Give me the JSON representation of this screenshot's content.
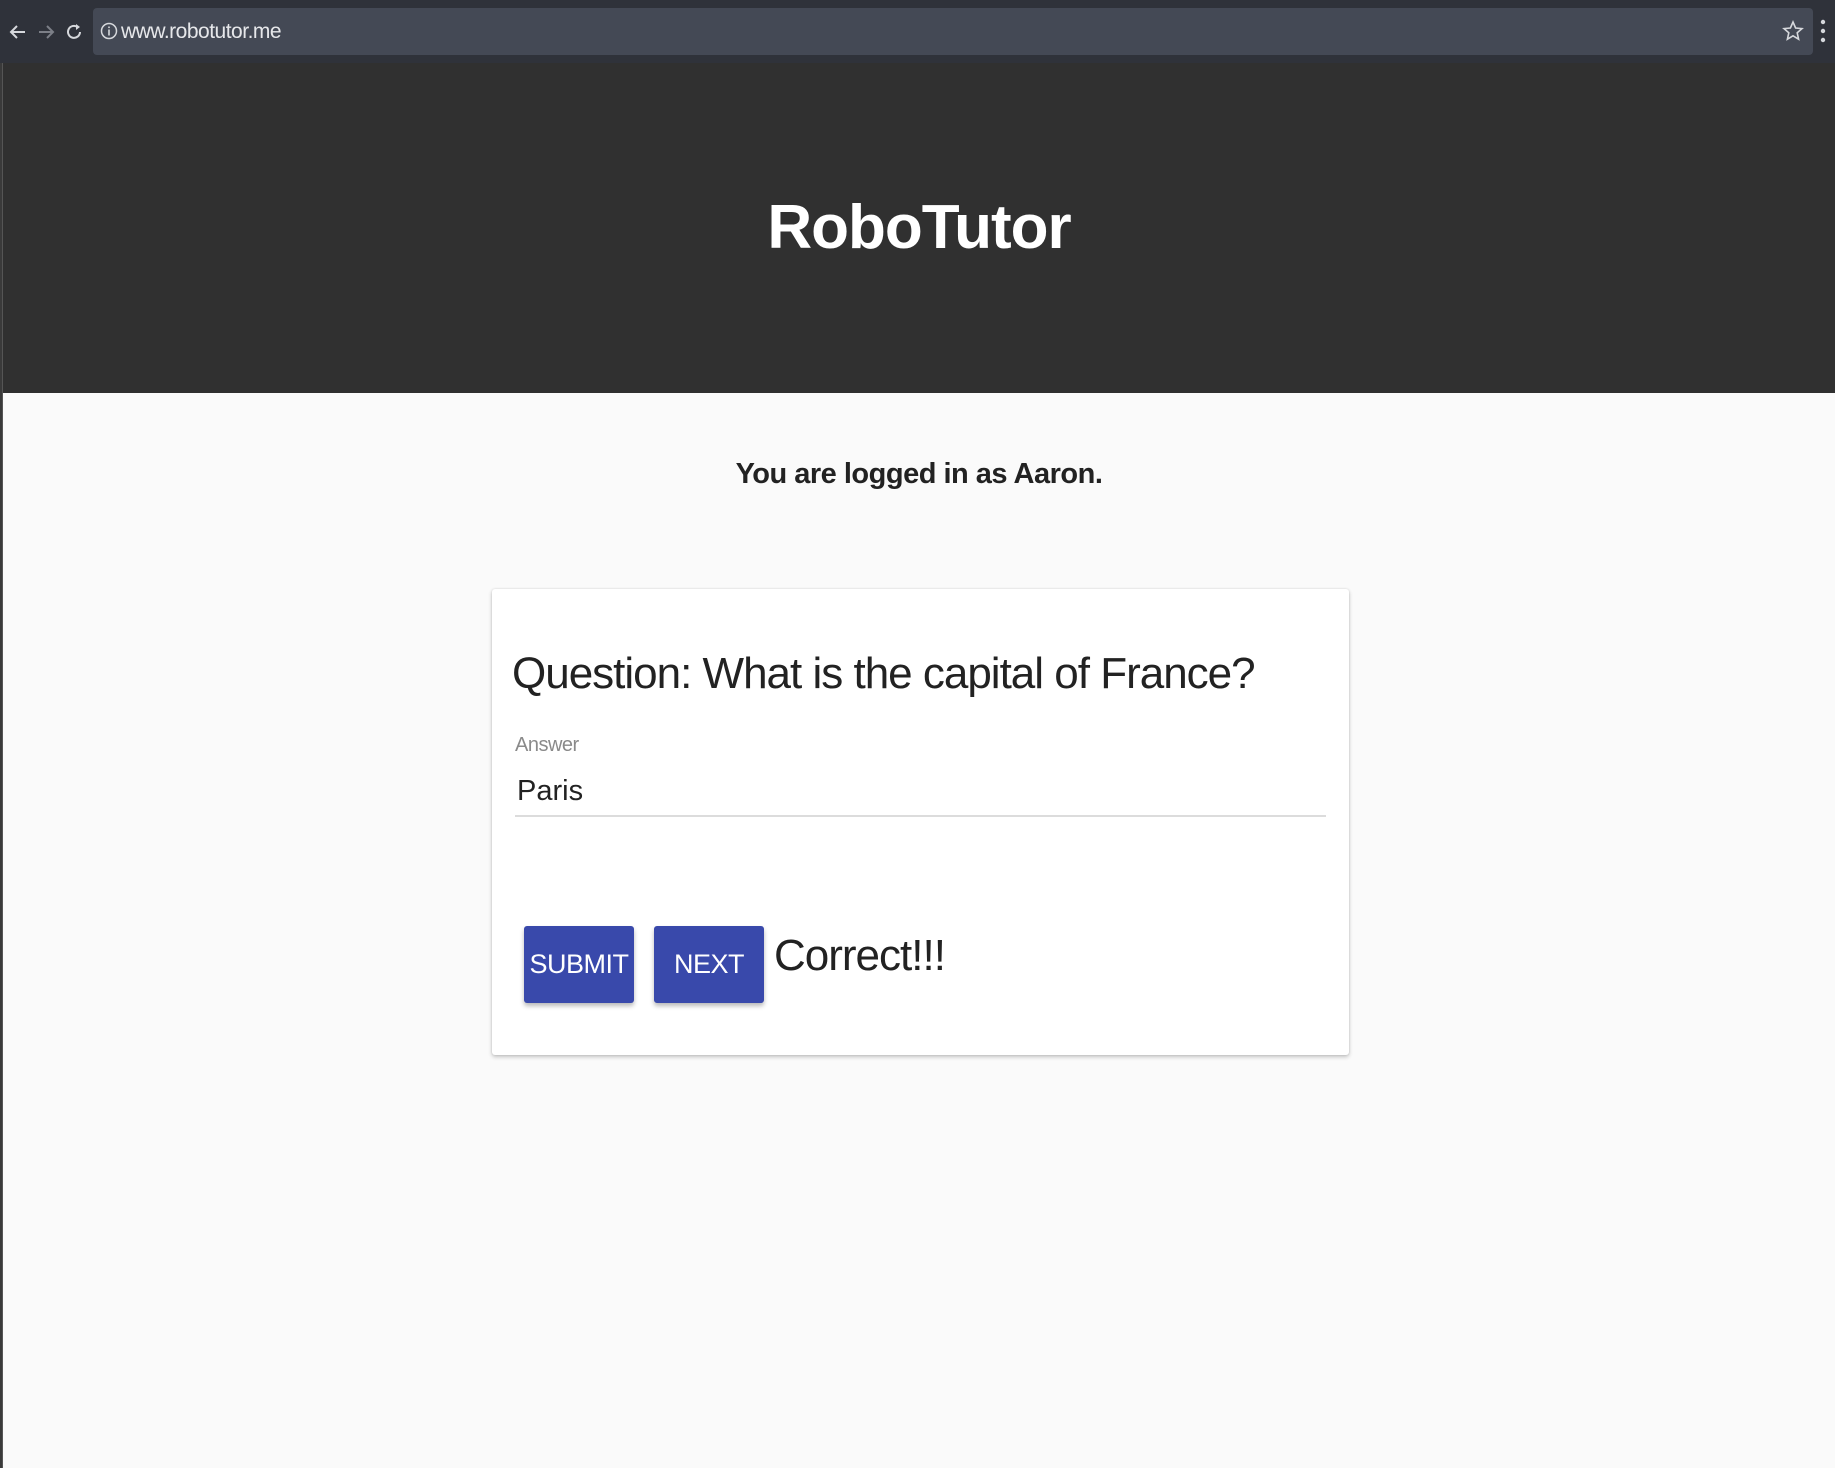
{
  "browser": {
    "url": "www.robotutor.me",
    "icons": {
      "back": "back-arrow-icon",
      "forward": "forward-arrow-icon",
      "reload": "reload-icon",
      "info": "info-icon",
      "bookmark": "star-icon",
      "menu": "vertical-dots-icon"
    }
  },
  "header": {
    "title": "RoboTutor"
  },
  "status": {
    "login_text": "You are logged in as Aaron."
  },
  "quiz": {
    "question": "Question: What is the capital of France?",
    "answer_label": "Answer",
    "answer_value": "Paris",
    "submit_label": "SUBMIT",
    "next_label": "NEXT",
    "result": "Correct!!!"
  },
  "colors": {
    "header_bg": "#303030",
    "accent": "#3949ab",
    "page_bg": "#fafafa"
  }
}
